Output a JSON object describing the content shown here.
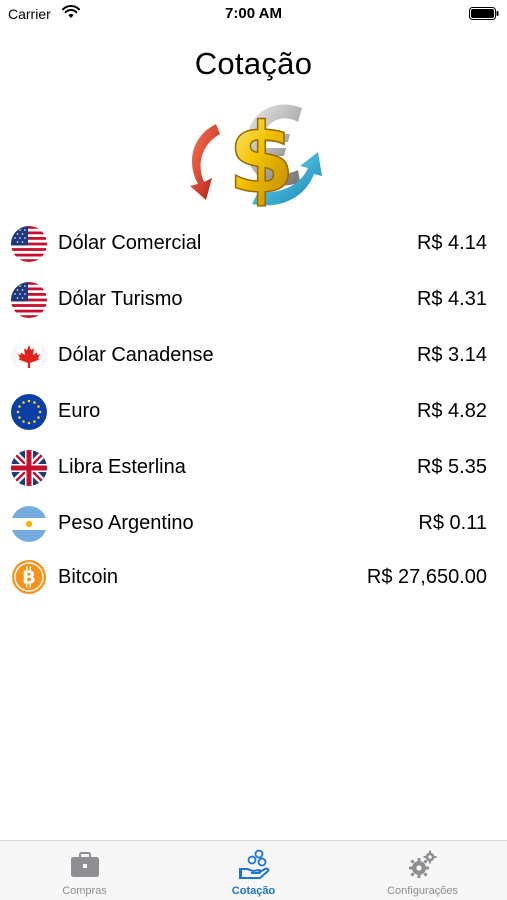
{
  "status_bar": {
    "carrier": "Carrier",
    "time": "7:00 AM",
    "wifi_icon": "wifi-icon",
    "battery_icon": "battery-icon"
  },
  "header": {
    "title": "Cotação",
    "logo_icon": "currency-exchange-icon"
  },
  "rates": [
    {
      "name": "Dólar Comercial",
      "value": "R$ 4.14",
      "flag_icon": "us-flag-icon"
    },
    {
      "name": "Dólar Turismo",
      "value": "R$ 4.31",
      "flag_icon": "us-flag-icon"
    },
    {
      "name": "Dólar Canadense",
      "value": "R$ 3.14",
      "flag_icon": "canada-flag-icon"
    },
    {
      "name": "Euro",
      "value": "R$ 4.82",
      "flag_icon": "eu-flag-icon"
    },
    {
      "name": "Libra Esterlina",
      "value": "R$ 5.35",
      "flag_icon": "uk-flag-icon"
    },
    {
      "name": "Peso Argentino",
      "value": "R$ 0.11",
      "flag_icon": "argentina-flag-icon"
    },
    {
      "name": "Bitcoin",
      "value": "R$ 27,650.00",
      "flag_icon": "bitcoin-icon"
    }
  ],
  "tab_bar": {
    "tabs": [
      {
        "label": "Compras",
        "icon": "briefcase-icon",
        "active": false
      },
      {
        "label": "Cotação",
        "icon": "money-hand-icon",
        "active": true
      },
      {
        "label": "Configurações",
        "icon": "gears-icon",
        "active": false
      }
    ]
  },
  "colors": {
    "accent": "#1a73d6",
    "inactive_tab": "#8e8e93",
    "tab_bar_bg": "#f7f7f7"
  }
}
